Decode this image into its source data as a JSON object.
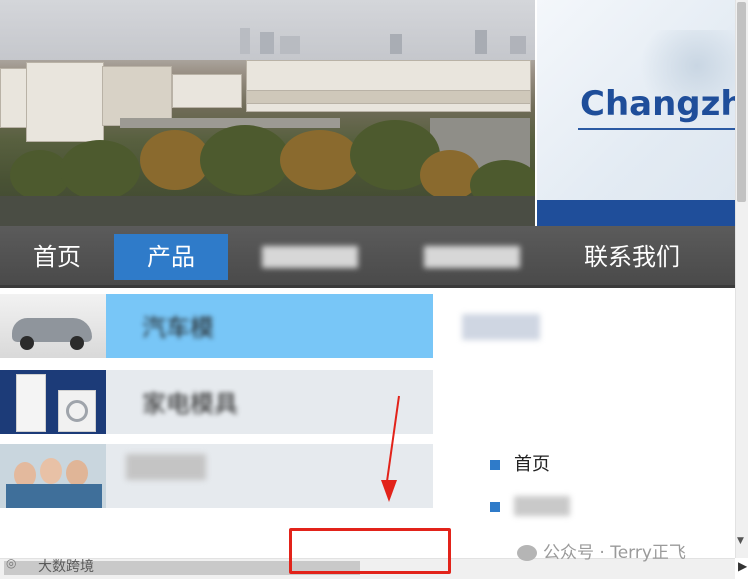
{
  "banner": {
    "logo_text": "Changzh",
    "colors": {
      "brand": "#1f4e9a",
      "nav_bg": "#4f4f4f",
      "nav_active": "#2f7bc9",
      "category_selected": "#78c6f7"
    }
  },
  "nav": {
    "items": [
      {
        "label": "首页",
        "active": false
      },
      {
        "label": "产品",
        "active": true
      },
      {
        "label": "",
        "active": false
      },
      {
        "label": "",
        "active": false
      },
      {
        "label": "联系我们",
        "active": false
      }
    ]
  },
  "categories": [
    {
      "thumb": "car-image",
      "label": "汽车模",
      "selected": true
    },
    {
      "thumb": "appliance-image",
      "label": "家电模具",
      "selected": false
    },
    {
      "thumb": "medical-staff-image",
      "label": "",
      "selected": false
    }
  ],
  "side_panel": {
    "title": "",
    "items": [
      {
        "icon": "square-bullet-icon",
        "label": "首页"
      },
      {
        "icon": "square-bullet-icon",
        "label": ""
      }
    ]
  },
  "watermarks": {
    "left": "大数跨境",
    "right": "公众号 · Terry正飞"
  }
}
